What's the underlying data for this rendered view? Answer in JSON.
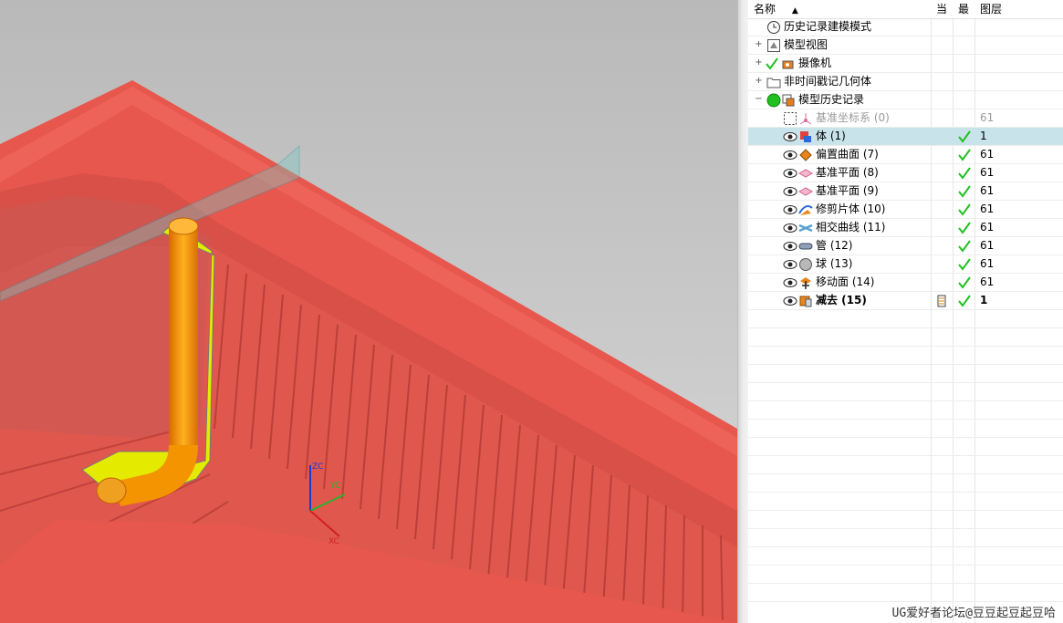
{
  "navigator": {
    "columns": {
      "name": "名称",
      "current": "当",
      "latest": "最",
      "layer": "图层"
    },
    "nodes": [
      {
        "label": "历史记录建模模式",
        "icon": "clock-icon",
        "expander": "",
        "latest": "",
        "layer": ""
      },
      {
        "label": "模型视图",
        "icon": "model-views-icon",
        "expander": "+",
        "latest": "",
        "layer": ""
      },
      {
        "label": "摄像机",
        "icon": "camera-icon",
        "expander": "+",
        "latest": "",
        "layer": ""
      },
      {
        "label": "非时间戳记几何体",
        "icon": "folder-icon",
        "expander": "+",
        "latest": "",
        "layer": ""
      },
      {
        "label": "模型历史记录",
        "icon": "model-history-icon",
        "expander": "−",
        "latest": "",
        "layer": ""
      },
      {
        "label": "基准坐标系 (0)",
        "icon": "datum-csys-icon",
        "expander": "",
        "latest": "",
        "layer": "61"
      },
      {
        "label": "体 (1)",
        "icon": "body-icon",
        "expander": "",
        "latest": "✓",
        "layer": "1"
      },
      {
        "label": "偏置曲面 (7)",
        "icon": "offset-surface-icon",
        "expander": "",
        "latest": "✓",
        "layer": "61"
      },
      {
        "label": "基准平面 (8)",
        "icon": "datum-plane-icon",
        "expander": "",
        "latest": "✓",
        "layer": "61"
      },
      {
        "label": "基准平面 (9)",
        "icon": "datum-plane-icon",
        "expander": "",
        "latest": "✓",
        "layer": "61"
      },
      {
        "label": "修剪片体 (10)",
        "icon": "trim-sheet-icon",
        "expander": "",
        "latest": "✓",
        "layer": "61"
      },
      {
        "label": "相交曲线 (11)",
        "icon": "intersection-curve-icon",
        "expander": "",
        "latest": "✓",
        "layer": "61"
      },
      {
        "label": "管 (12)",
        "icon": "tube-icon",
        "expander": "",
        "latest": "✓",
        "layer": "61"
      },
      {
        "label": "球 (13)",
        "icon": "sphere-icon",
        "expander": "",
        "latest": "✓",
        "layer": "61"
      },
      {
        "label": "移动面 (14)",
        "icon": "move-face-icon",
        "expander": "",
        "latest": "✓",
        "layer": "61"
      },
      {
        "label": "减去 (15)",
        "icon": "subtract-icon",
        "expander": "",
        "latest": "✓",
        "layer": "1"
      }
    ]
  },
  "viewport": {
    "axis_labels": {
      "z": "ZC",
      "y": "YC",
      "x": "XC"
    },
    "colors": {
      "background": "#c4c4c4",
      "mold": "#e6584f",
      "tube": "#f08a00",
      "sheet": "#e8f000",
      "plane": "#3aa0a0"
    }
  },
  "watermark": "UG爱好者论坛@豆豆起豆起豆哈"
}
